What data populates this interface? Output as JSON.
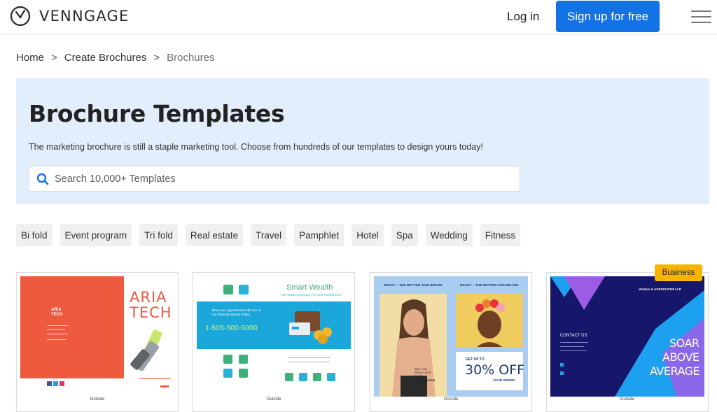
{
  "header": {
    "brand": "VENNGAGE",
    "login": "Log in",
    "signup": "Sign up for free"
  },
  "breadcrumb": {
    "home": "Home",
    "sep1": ">",
    "parent": "Create Brochures",
    "sep2": ">",
    "current": "Brochures"
  },
  "hero": {
    "title": "Brochure Templates",
    "description": "The marketing brochure is still a staple marketing tool. Choose from hundreds of our templates to design yours today!",
    "search_placeholder": "Search 10,000+ Templates"
  },
  "chips": [
    "Bi fold",
    "Event program",
    "Tri fold",
    "Real estate",
    "Travel",
    "Pamphlet",
    "Hotel",
    "Spa",
    "Wedding",
    "Fitness"
  ],
  "cards": [
    {
      "caption": "Outside",
      "title1": "ARIA",
      "title2": "TECH",
      "small_title1": "ARIA",
      "small_title2": "TECH"
    },
    {
      "caption": "Outside",
      "title": "Smart Wealth",
      "subtitle": "The Smartest Choice For Your Investments",
      "booking": "Book your appointment with one of our financial experts today!",
      "phone": "1-505-500-5000"
    },
    {
      "caption": "Outside",
      "brand_left": "READY – THE BETTER SKIN BRAND",
      "brand_right": "READY – THE BETTER SKIN BRAND",
      "question": "ARE YOU READY FOR THIS?",
      "site": "BeReady.com",
      "offer_top": "GET UP TO",
      "offer": "30% OFF",
      "offer_bottom": "YOUR ORDER!"
    },
    {
      "caption": "Outside",
      "badge": "Business",
      "company": "Venture & ASSOCIATES LLP",
      "contact": "CONTACT US",
      "line1": "SOAR",
      "line2": "ABOVE",
      "line3": "AVERAGE"
    }
  ],
  "colors": {
    "accent": "#1272e6",
    "hero_bg": "#e3eefc",
    "badge": "#f7b500"
  }
}
